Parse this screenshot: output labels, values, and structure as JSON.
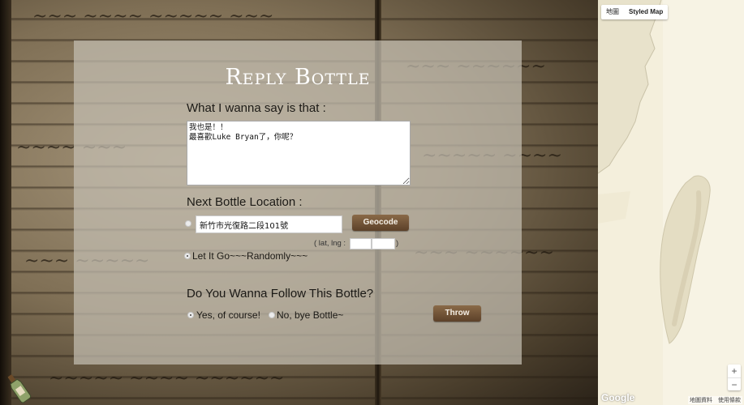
{
  "title": "Reply Bottle",
  "message_label": "What I wanna say is that :",
  "message_value": "我也是！！\n最喜歡Luke Bryan了，你呢？",
  "location_label": "Next Bottle Location :",
  "address_value": "新竹市光復路二段101號",
  "geocode_label": "Geocode",
  "latlng_text": "( lat, lng :",
  "latlng_close": ")",
  "random_label": "Let It Go~~~Randomly~~~",
  "follow_label": "Do You Wanna Follow This Bottle?",
  "follow_yes": "Yes, of course!",
  "follow_no": "No, bye Bottle~",
  "throw_label": "Throw",
  "map": {
    "type_map": "地圖",
    "type_styled": "Styled Map",
    "zoom_in": "+",
    "zoom_out": "−",
    "google_logo": "Google",
    "attribution": "地圖資料　使用條款"
  },
  "colors": {
    "panel": "#c4beb2",
    "button": "#6e5236",
    "map_land": "#f4efdc"
  },
  "icons": {
    "bottle": "bottle-icon"
  }
}
